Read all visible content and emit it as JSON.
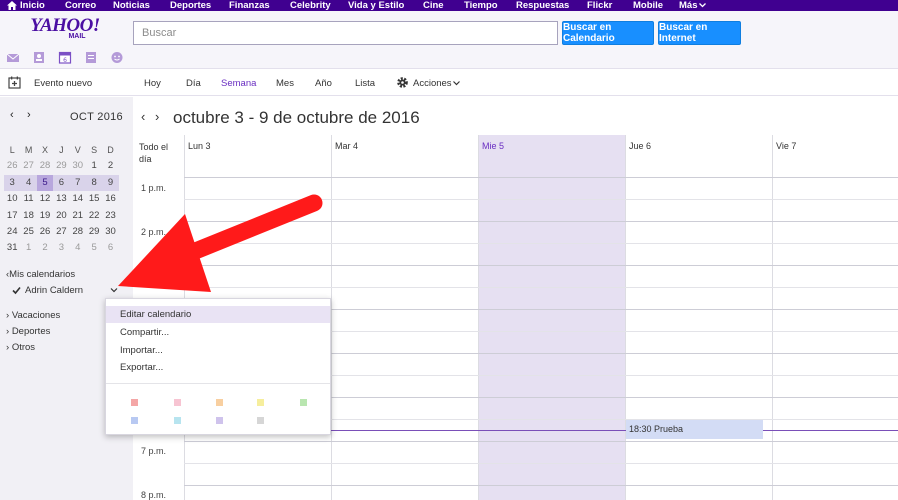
{
  "topnav": {
    "items": [
      "Inicio",
      "Correo",
      "Noticias",
      "Deportes",
      "Finanzas",
      "Celebrity",
      "Vida y Estilo",
      "Cine",
      "Tiempo",
      "Respuestas",
      "Flickr",
      "Mobile",
      "Más"
    ]
  },
  "header": {
    "logo_big": "YAHOO!",
    "logo_small": "MAIL",
    "search_placeholder": "Buscar",
    "search_calendar_label": "Buscar en Calendario",
    "search_web_label": "Buscar en Internet"
  },
  "toolbar": {
    "new_event_label": "Evento nuevo",
    "views": [
      "Hoy",
      "Día",
      "Semana",
      "Mes",
      "Año",
      "Lista"
    ],
    "active_view": "Semana",
    "actions_label": "Acciones"
  },
  "mini_calendar": {
    "month_label": "OCT 2016",
    "weekdays": [
      "L",
      "M",
      "X",
      "J",
      "V",
      "S",
      "D"
    ],
    "weeks": [
      [
        "26",
        "27",
        "28",
        "29",
        "30",
        "1",
        "2"
      ],
      [
        "3",
        "4",
        "5",
        "6",
        "7",
        "8",
        "9"
      ],
      [
        "10",
        "11",
        "12",
        "13",
        "14",
        "15",
        "16"
      ],
      [
        "17",
        "18",
        "19",
        "20",
        "21",
        "22",
        "23"
      ],
      [
        "24",
        "25",
        "26",
        "27",
        "28",
        "29",
        "30"
      ],
      [
        "31",
        "1",
        "2",
        "3",
        "4",
        "5",
        "6"
      ]
    ]
  },
  "sidebar": {
    "my_calendars_label": "Mis calendarios",
    "my_calendar_name": "Adrin Caldern",
    "other_sections": [
      "Vacaciones",
      "Deportes",
      "Otros"
    ]
  },
  "main": {
    "range_title": "octubre 3 - 9 de octubre de 2016",
    "allday_label": "Todo el día",
    "days": [
      "Lun 3",
      "Mar 4",
      "Mie 5",
      "Jue 6",
      "Vie 7"
    ],
    "hours": [
      "1 p.m.",
      "2 p.m.",
      "7 p.m.",
      "8 p.m."
    ],
    "event_label": "18:30 Prueba"
  },
  "dropdown": {
    "items": [
      "Editar calendario",
      "Compartir...",
      "Importar...",
      "Exportar..."
    ],
    "swatch_colors": [
      "#f4a6a6",
      "#f7c4d2",
      "#f8cfa0",
      "#f6ee9d",
      "#b9e6b0",
      "#b8c9f2",
      "#b7e4ef",
      "#cfc3ec",
      "#d6d6d6"
    ]
  }
}
